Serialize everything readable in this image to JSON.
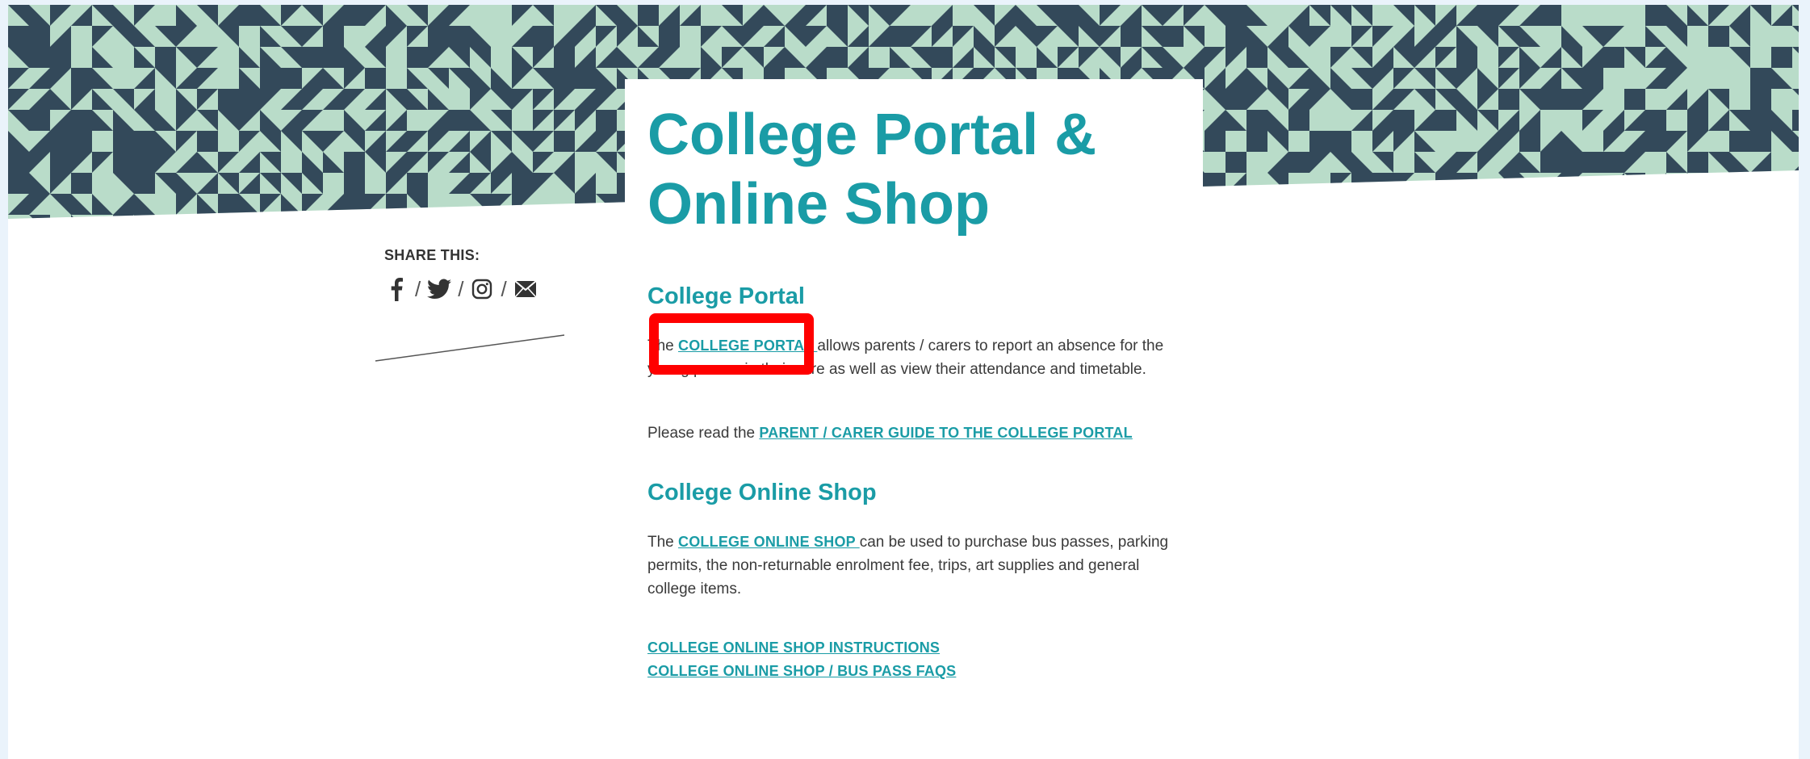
{
  "page": {
    "title": "College Portal & Online Shop"
  },
  "share": {
    "label": "SHARE THIS:",
    "icons": [
      "facebook-icon",
      "twitter-icon",
      "instagram-icon",
      "email-icon"
    ],
    "separator": "/"
  },
  "portal_section": {
    "heading": "College Portal",
    "para1_prefix": "The ",
    "para1_link": "COLLEGE PORTAL ",
    "para1_suffix": "allows parents / carers to report an absence for the young person in their care as well as view their attendance and timetable.",
    "para2_prefix": "Please read the ",
    "para2_link": "PARENT / CARER GUIDE TO THE COLLEGE PORTAL  "
  },
  "shop_section": {
    "heading": "College Online Shop",
    "para_prefix": "The ",
    "para_link": "COLLEGE ONLINE SHOP ",
    "para_suffix": "can be used to purchase bus passes, parking permits, the non-returnable enrolment fee, trips, art supplies and general college items.",
    "link_instructions": "COLLEGE ONLINE SHOP INSTRUCTIONS",
    "link_faqs": "COLLEGE ONLINE SHOP / BUS PASS FAQS"
  },
  "colors": {
    "accent": "#1a9ca6",
    "pattern_dark": "#33495a",
    "pattern_light": "#b9dcc9",
    "highlight": "#ff0000"
  }
}
